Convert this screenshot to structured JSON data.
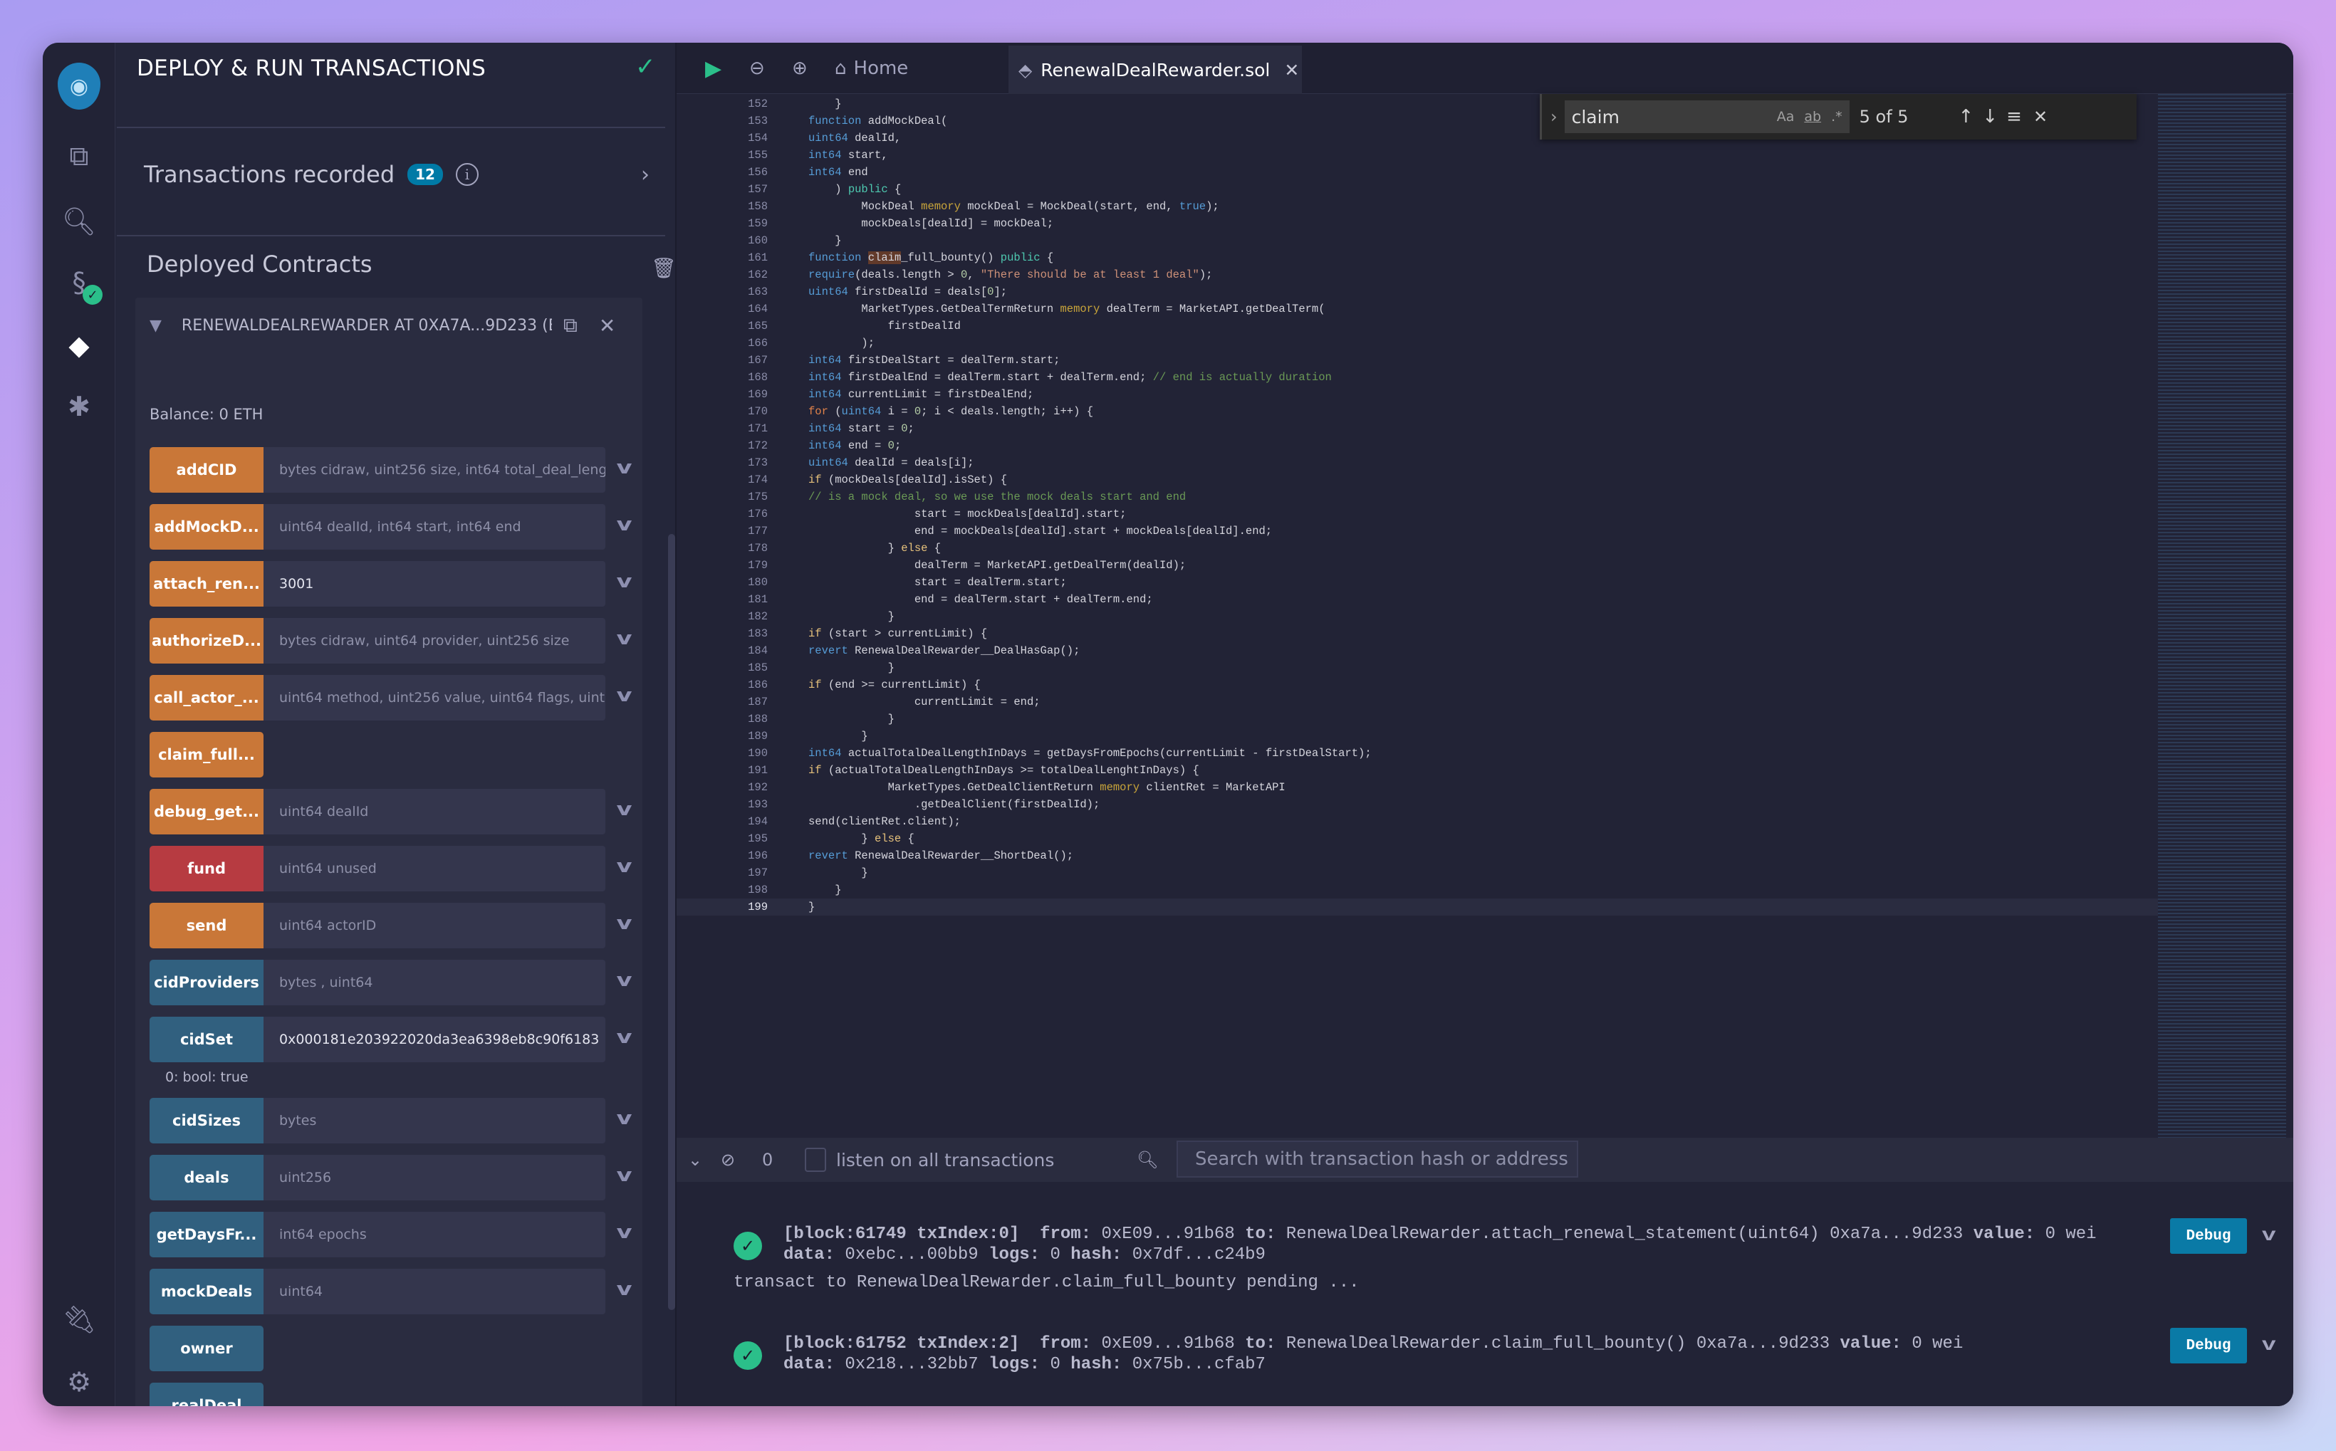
{
  "icon_bar": {
    "items": [
      "remix-logo-icon",
      "file-explorer-icon",
      "search-icon",
      "solidity-compiler-icon",
      "deploy-run-icon",
      "debugger-icon",
      "plugin-manager-icon",
      "settings-gear-icon"
    ]
  },
  "panel": {
    "title": "DEPLOY & RUN TRANSACTIONS",
    "transactions_label": "Transactions recorded",
    "transactions_count": "12",
    "deployed_label": "Deployed Contracts",
    "contract": {
      "name": "RENEWALDEALREWARDER AT 0XA7A...9D233 (E",
      "balance": "Balance: 0 ETH",
      "functions": [
        {
          "label": "addCID",
          "color": "orange",
          "placeholder": "bytes cidraw, uint256 size, int64 total_deal_leng"
        },
        {
          "label": "addMockD...",
          "color": "orange",
          "placeholder": "uint64 dealId, int64 start, int64 end"
        },
        {
          "label": "attach_ren...",
          "color": "orange",
          "value": "3001"
        },
        {
          "label": "authorizeD...",
          "color": "orange",
          "placeholder": "bytes cidraw, uint64 provider, uint256 size"
        },
        {
          "label": "call_actor_...",
          "color": "orange",
          "placeholder": "uint64 method, uint256 value, uint64 flags, uint64"
        },
        {
          "label": "claim_full...",
          "color": "orange"
        },
        {
          "label": "debug_get...",
          "color": "orange",
          "placeholder": "uint64 dealId"
        },
        {
          "label": "fund",
          "color": "red",
          "placeholder": "uint64 unused"
        },
        {
          "label": "send",
          "color": "orange",
          "placeholder": "uint64 actorID"
        },
        {
          "label": "cidProviders",
          "color": "blue",
          "placeholder": "bytes , uint64"
        },
        {
          "label": "cidSet",
          "color": "blue",
          "value": "0x000181e203922020da3ea6398eb8c90f6183",
          "output": "0: bool: true"
        },
        {
          "label": "cidSizes",
          "color": "blue",
          "placeholder": "bytes"
        },
        {
          "label": "deals",
          "color": "blue",
          "placeholder": "uint256"
        },
        {
          "label": "getDaysFr...",
          "color": "blue",
          "placeholder": "int64 epochs"
        },
        {
          "label": "mockDeals",
          "color": "blue",
          "placeholder": "uint64"
        },
        {
          "label": "owner",
          "color": "blue"
        },
        {
          "label": "realDeal",
          "color": "blue"
        }
      ]
    }
  },
  "colors": {
    "orange": "#c97738",
    "red": "#b73b41",
    "blue": "#31607f",
    "badge": "#007aa6",
    "success": "#2bbf8a"
  },
  "editor": {
    "home_tab": "Home",
    "active_tab": "RenewalDealRewarder.sol",
    "find": {
      "query": "claim",
      "case_opt": "Aa",
      "word_opt": "ab",
      "regex_opt": ".*",
      "count": "5 of 5"
    },
    "current_line": 199,
    "lines": [
      {
        "n": 152,
        "ind": 4,
        "t": [
          [
            "t",
            "}"
          ]
        ]
      },
      {
        "n": 153,
        "ind": 0,
        "t": [
          [
            "k",
            "function"
          ],
          [
            "t",
            " addMockDeal("
          ]
        ]
      },
      {
        "n": 154,
        "ind": 0,
        "t": [
          [
            "k",
            "uint64"
          ],
          [
            "t",
            " dealId,"
          ]
        ]
      },
      {
        "n": 155,
        "ind": 0,
        "t": [
          [
            "k",
            "int64"
          ],
          [
            "t",
            " start,"
          ]
        ]
      },
      {
        "n": 156,
        "ind": 0,
        "t": [
          [
            "k",
            "int64"
          ],
          [
            "t",
            " end"
          ]
        ]
      },
      {
        "n": 157,
        "ind": 4,
        "t": [
          [
            "t",
            ") "
          ],
          [
            "p",
            "public"
          ],
          [
            "t",
            " {"
          ]
        ]
      },
      {
        "n": 158,
        "ind": 8,
        "t": [
          [
            "t",
            "MockDeal "
          ],
          [
            "m",
            "memory"
          ],
          [
            "t",
            " mockDeal = MockDeal(start, end, "
          ],
          [
            "k",
            "true"
          ],
          [
            "t",
            ");"
          ]
        ]
      },
      {
        "n": 159,
        "ind": 8,
        "t": [
          [
            "t",
            "mockDeals[dealId] = mockDeal;"
          ]
        ]
      },
      {
        "n": 160,
        "ind": 4,
        "t": [
          [
            "t",
            "}"
          ]
        ]
      },
      {
        "n": 161,
        "ind": 0,
        "t": [
          [
            "k",
            "function"
          ],
          [
            "t",
            " "
          ],
          [
            "hl",
            "claim"
          ],
          [
            "t",
            "_full_bounty() "
          ],
          [
            "p",
            "public"
          ],
          [
            "t",
            " {"
          ]
        ]
      },
      {
        "n": 162,
        "ind": 0,
        "t": [
          [
            "k",
            "require"
          ],
          [
            "t",
            "(deals.length > "
          ],
          [
            "n",
            "0"
          ],
          [
            "t",
            ", "
          ],
          [
            "s",
            "\"There should be at least 1 deal\""
          ],
          [
            "t",
            ");"
          ]
        ]
      },
      {
        "n": 163,
        "ind": 0,
        "t": [
          [
            "k",
            "uint64"
          ],
          [
            "t",
            " firstDealId = deals["
          ],
          [
            "n",
            "0"
          ],
          [
            "t",
            "];"
          ]
        ]
      },
      {
        "n": 164,
        "ind": 8,
        "t": [
          [
            "t",
            "MarketTypes.GetDealTermReturn "
          ],
          [
            "m",
            "memory"
          ],
          [
            "t",
            " dealTerm = MarketAPI.getDealTerm("
          ]
        ]
      },
      {
        "n": 165,
        "ind": 12,
        "t": [
          [
            "t",
            "firstDealId"
          ]
        ]
      },
      {
        "n": 166,
        "ind": 8,
        "t": [
          [
            "t",
            ");"
          ]
        ]
      },
      {
        "n": 167,
        "ind": 0,
        "t": [
          [
            "k",
            "int64"
          ],
          [
            "t",
            " firstDealStart = dealTerm.start;"
          ]
        ]
      },
      {
        "n": 168,
        "ind": 0,
        "t": [
          [
            "k",
            "int64"
          ],
          [
            "t",
            " firstDealEnd = dealTerm.start + dealTerm.end; "
          ],
          [
            "c",
            "// end is actually duration"
          ]
        ]
      },
      {
        "n": 169,
        "ind": 0,
        "t": [
          [
            "k",
            "int64"
          ],
          [
            "t",
            " currentLimit = firstDealEnd;"
          ]
        ]
      },
      {
        "n": 170,
        "ind": 0,
        "t": [
          [
            "f",
            "for"
          ],
          [
            "t",
            " ("
          ],
          [
            "k",
            "uint64"
          ],
          [
            "t",
            " i = "
          ],
          [
            "n",
            "0"
          ],
          [
            "t",
            "; i < deals.length; i++) {"
          ]
        ]
      },
      {
        "n": 171,
        "ind": 0,
        "t": [
          [
            "k",
            "int64"
          ],
          [
            "t",
            " start = "
          ],
          [
            "n",
            "0"
          ],
          [
            "t",
            ";"
          ]
        ]
      },
      {
        "n": 172,
        "ind": 0,
        "t": [
          [
            "k",
            "int64"
          ],
          [
            "t",
            " end = "
          ],
          [
            "n",
            "0"
          ],
          [
            "t",
            ";"
          ]
        ]
      },
      {
        "n": 173,
        "ind": 0,
        "t": [
          [
            "k",
            "uint64"
          ],
          [
            "t",
            " dealId = deals[i];"
          ]
        ]
      },
      {
        "n": 174,
        "ind": 0,
        "t": [
          [
            "i",
            "if"
          ],
          [
            "t",
            " (mockDeals[dealId].isSet) {"
          ]
        ]
      },
      {
        "n": 175,
        "ind": 0,
        "t": [
          [
            "c",
            "// is a mock deal, so we use the mock deals start and end"
          ]
        ]
      },
      {
        "n": 176,
        "ind": 16,
        "t": [
          [
            "t",
            "start = mockDeals[dealId].start;"
          ]
        ]
      },
      {
        "n": 177,
        "ind": 16,
        "t": [
          [
            "t",
            "end = mockDeals[dealId].start + mockDeals[dealId].end;"
          ]
        ]
      },
      {
        "n": 178,
        "ind": 12,
        "t": [
          [
            "t",
            "} "
          ],
          [
            "i",
            "else"
          ],
          [
            "t",
            " {"
          ]
        ]
      },
      {
        "n": 179,
        "ind": 16,
        "t": [
          [
            "t",
            "dealTerm = MarketAPI.getDealTerm(dealId);"
          ]
        ]
      },
      {
        "n": 180,
        "ind": 16,
        "t": [
          [
            "t",
            "start = dealTerm.start;"
          ]
        ]
      },
      {
        "n": 181,
        "ind": 16,
        "t": [
          [
            "t",
            "end = dealTerm.start + dealTerm.end;"
          ]
        ]
      },
      {
        "n": 182,
        "ind": 12,
        "t": [
          [
            "t",
            "}"
          ]
        ]
      },
      {
        "n": 183,
        "ind": 0,
        "t": [
          [
            "i",
            "if"
          ],
          [
            "t",
            " (start > currentLimit) {"
          ]
        ]
      },
      {
        "n": 184,
        "ind": 0,
        "t": [
          [
            "k",
            "revert"
          ],
          [
            "t",
            " RenewalDealRewarder__DealHasGap();"
          ]
        ]
      },
      {
        "n": 185,
        "ind": 12,
        "t": [
          [
            "t",
            "}"
          ]
        ]
      },
      {
        "n": 186,
        "ind": 0,
        "t": [
          [
            "i",
            "if"
          ],
          [
            "t",
            " (end >= currentLimit) {"
          ]
        ]
      },
      {
        "n": 187,
        "ind": 16,
        "t": [
          [
            "t",
            "currentLimit = end;"
          ]
        ]
      },
      {
        "n": 188,
        "ind": 12,
        "t": [
          [
            "t",
            "}"
          ]
        ]
      },
      {
        "n": 189,
        "ind": 8,
        "t": [
          [
            "t",
            "}"
          ]
        ]
      },
      {
        "n": 190,
        "ind": 0,
        "t": [
          [
            "k",
            "int64"
          ],
          [
            "t",
            " actualTotalDealLengthInDays = getDaysFromEpochs(currentLimit - firstDealStart);"
          ]
        ]
      },
      {
        "n": 191,
        "ind": 0,
        "t": [
          [
            "i",
            "if"
          ],
          [
            "t",
            " (actualTotalDealLengthInDays >= totalDealLenghtInDays) {"
          ]
        ]
      },
      {
        "n": 192,
        "ind": 12,
        "t": [
          [
            "t",
            "MarketTypes.GetDealClientReturn "
          ],
          [
            "m",
            "memory"
          ],
          [
            "t",
            " clientRet = MarketAPI"
          ]
        ]
      },
      {
        "n": 193,
        "ind": 16,
        "t": [
          [
            "t",
            ".getDealClient(firstDealId);"
          ]
        ]
      },
      {
        "n": 194,
        "ind": 0,
        "t": [
          [
            "t",
            "send(clientRet.client);"
          ]
        ]
      },
      {
        "n": 195,
        "ind": 8,
        "t": [
          [
            "t",
            "} "
          ],
          [
            "i",
            "else"
          ],
          [
            "t",
            " {"
          ]
        ]
      },
      {
        "n": 196,
        "ind": 0,
        "t": [
          [
            "k",
            "revert"
          ],
          [
            "t",
            " RenewalDealRewarder__ShortDeal();"
          ]
        ]
      },
      {
        "n": 197,
        "ind": 8,
        "t": [
          [
            "t",
            "}"
          ]
        ]
      },
      {
        "n": 198,
        "ind": 4,
        "t": [
          [
            "t",
            "}"
          ]
        ]
      },
      {
        "n": 199,
        "ind": 0,
        "t": [
          [
            "t",
            "}"
          ]
        ]
      }
    ]
  },
  "terminal": {
    "pending_count": "0",
    "listen_label": "listen on all transactions",
    "search_placeholder": "Search with transaction hash or address",
    "debug_label": "Debug",
    "prompt": ">",
    "pending_line": "transact to RenewalDealRewarder.claim_full_bounty pending ...",
    "entries": [
      {
        "block": "[block:61749 txIndex:0]",
        "from": "0xE09...91b68",
        "to": "RenewalDealRewarder.attach_renewal_statement(uint64) 0xa7a...9d233",
        "value": "0 wei",
        "data": "0xebc...00bb9",
        "logs": "0",
        "hash": "0x7df...c24b9"
      },
      {
        "block": "[block:61752 txIndex:2]",
        "from": "0xE09...91b68",
        "to": "RenewalDealRewarder.claim_full_bounty() 0xa7a...9d233",
        "value": "0 wei",
        "data": "0x218...32bb7",
        "logs": "0",
        "hash": "0x75b...cfab7"
      }
    ],
    "labels": {
      "from": "from:",
      "to": "to:",
      "value": "value:",
      "data": "data:",
      "logs": "logs:",
      "hash": "hash:"
    }
  }
}
